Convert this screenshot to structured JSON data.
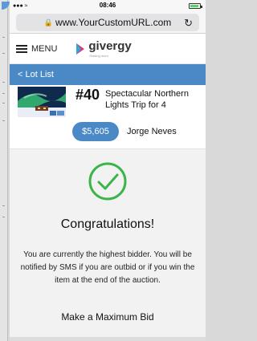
{
  "status_bar": {
    "time": "08:46"
  },
  "browser": {
    "url": "www.YourCustomURL.com"
  },
  "header": {
    "menu_label": "MENU",
    "brand_name": "givergy",
    "brand_tagline": "Raising more"
  },
  "nav": {
    "back_label": "< Lot List"
  },
  "lot": {
    "number": "#40",
    "title": "Spectacular Northern Lights Trip for 4",
    "current_bid": "$5,605",
    "bidder": "Jorge Neves"
  },
  "confirmation": {
    "heading": "Congratulations!",
    "message": "You are currently the highest bidder. You will be notified by SMS if you are outbid or if you win the item at the end of the auction.",
    "next_section_title": "Make a Maximum Bid"
  },
  "colors": {
    "accent": "#4a89c6",
    "success": "#3bb54a"
  },
  "icons": [
    "lock-icon",
    "reload-icon",
    "hamburger-icon",
    "givergy-logo",
    "checkmark-icon"
  ]
}
